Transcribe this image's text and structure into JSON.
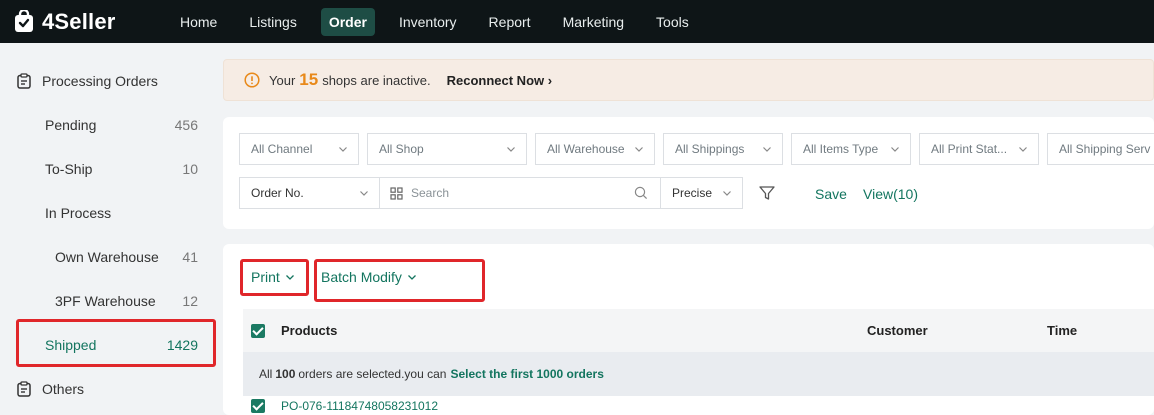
{
  "app": {
    "name": "4Seller",
    "brand_color": "#13755f",
    "nav_bg": "#0e1517"
  },
  "nav": {
    "items": [
      {
        "label": "Home"
      },
      {
        "label": "Listings"
      },
      {
        "label": "Order",
        "active": true
      },
      {
        "label": "Inventory"
      },
      {
        "label": "Report"
      },
      {
        "label": "Marketing"
      },
      {
        "label": "Tools"
      }
    ]
  },
  "sidebar": {
    "processing": {
      "label": "Processing Orders",
      "icon": "clipboard-icon"
    },
    "items": [
      {
        "label": "Pending",
        "count": "456"
      },
      {
        "label": "To-Ship",
        "count": "10"
      },
      {
        "label": "In Process",
        "count": ""
      },
      {
        "label": "Own Warehouse",
        "count": "41"
      },
      {
        "label": "3PF Warehouse",
        "count": "12"
      },
      {
        "label": "Shipped",
        "count": "1429",
        "active": true
      }
    ],
    "others": {
      "label": "Others",
      "icon": "clipboard-icon"
    }
  },
  "notice": {
    "prefix": "Your",
    "count": "15",
    "suffix": "shops are inactive.",
    "link": "Reconnect Now",
    "icon": "alert-circle-icon"
  },
  "filters": {
    "row1": [
      "All Channel",
      "All Shop",
      "All Warehouse",
      "All Shippings",
      "All Items Type",
      "All Print Stat...",
      "All Shipping Serv"
    ],
    "search_field": "Order No.",
    "search_placeholder": "Search",
    "match_mode": "Precise",
    "save_label": "Save",
    "view_label": "View(10)"
  },
  "actions": {
    "print_label": "Print",
    "batch_modify_label": "Batch Modify"
  },
  "table": {
    "columns": [
      "Products",
      "Customer",
      "Time"
    ],
    "select_banner": {
      "prefix": "All",
      "count": "100",
      "middle": "orders are selected.you can",
      "link": "Select the first 1000 orders"
    },
    "rows": [
      {
        "order_no": "PO-076-11184748058231012"
      }
    ]
  }
}
